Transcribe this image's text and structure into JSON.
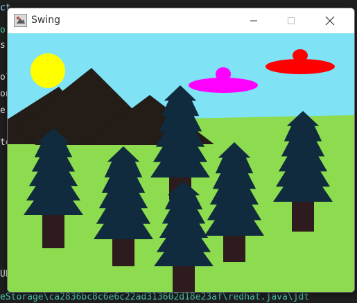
{
  "window": {
    "title": "Swing",
    "app_icon": "java-swing-icon",
    "controls": {
      "minimize": "minimize-icon",
      "maximize": "maximize-icon",
      "close": "close-icon"
    }
  },
  "background_text": {
    "bottom_path": "eStorage\\ca2836bc8c6e6c22ad313602d18e23af\\redhat.java\\jdt"
  },
  "scene": {
    "colors": {
      "sky": "#7fe2f5",
      "grass": "#8ddc4f",
      "sun": "#ffff00",
      "mountains": "#231c17",
      "tree_foliage": "#0f2b3d",
      "tree_trunk": "#2e1b1d",
      "ufo_magenta": "#ff00ff",
      "ufo_red": "#ff0000"
    }
  }
}
